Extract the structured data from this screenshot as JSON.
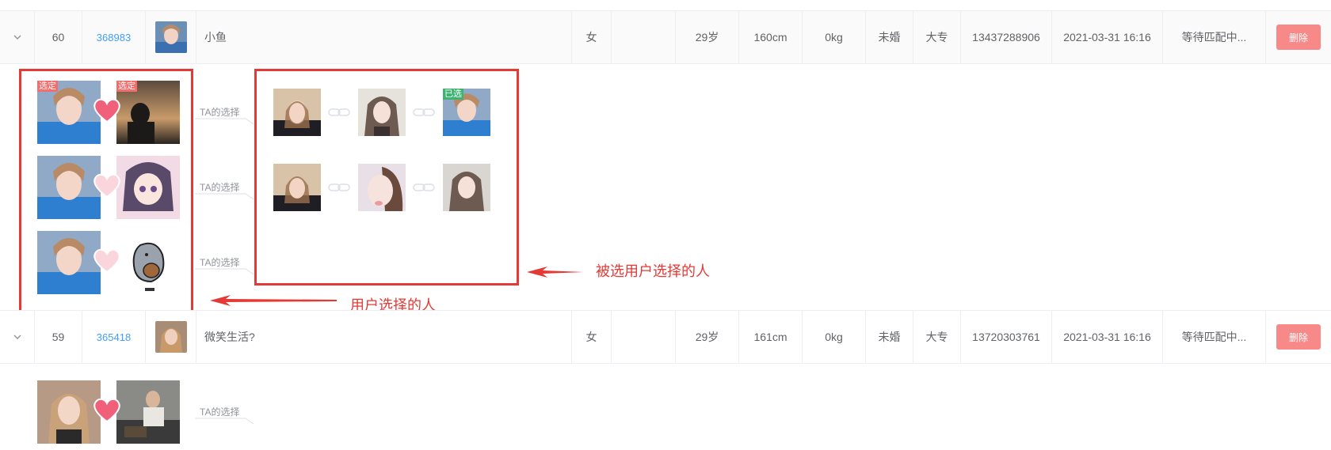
{
  "rows": [
    {
      "index": "60",
      "uid": "368983",
      "name": "小鱼",
      "gender": "女",
      "age": "29岁",
      "height": "160cm",
      "weight": "0kg",
      "marital": "未婚",
      "education": "大专",
      "phone": "13437288906",
      "time": "2021-03-31 16:16",
      "status": "等待匹配中...",
      "delete_label": "删除"
    },
    {
      "index": "59",
      "uid": "365418",
      "name": "微笑生活?",
      "gender": "女",
      "age": "29岁",
      "height": "161cm",
      "weight": "0kg",
      "marital": "未婚",
      "education": "大专",
      "phone": "13720303761",
      "time": "2021-03-31 16:16",
      "status": "等待匹配中...",
      "delete_label": "删除"
    }
  ],
  "expand": {
    "ta_choice_label": "TA的选择",
    "selected_tag": "选定",
    "chosen_tag": "已选"
  },
  "annotations": {
    "chosen_by_selected": "被选用户选择的人",
    "user_choices": "用户选择的人"
  },
  "colors": {
    "accent_link": "#409eff",
    "delete_button": "#f78989",
    "annotation_red": "#e53935",
    "heart_active": "#f0607a",
    "heart_inactive": "#fbd5dc"
  }
}
